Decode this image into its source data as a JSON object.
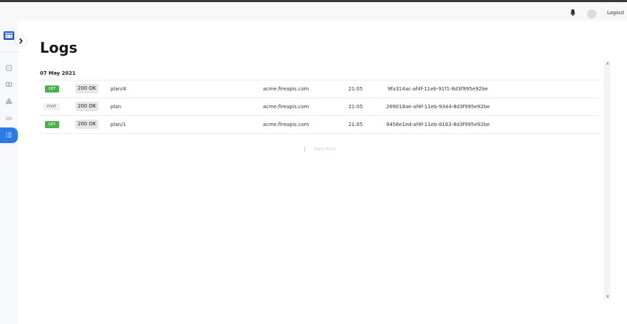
{
  "header": {
    "logout_label": "Logout",
    "icons": [
      "bell-icon",
      "avatar"
    ]
  },
  "sidebar": {
    "logo": "firetail-logo",
    "items": [
      {
        "icon": "document-icon",
        "active": false
      },
      {
        "icon": "id-card-icon",
        "active": false
      },
      {
        "icon": "integrations-icon",
        "active": false
      },
      {
        "icon": "code-icon",
        "active": false
      },
      {
        "icon": "list-icon",
        "active": true
      }
    ]
  },
  "page": {
    "title": "Logs"
  },
  "logs": {
    "date": "07 May 2021",
    "rows": [
      {
        "method": "GET",
        "status": "200 OK",
        "path": "plan/4",
        "host": "acme.fireapis.com",
        "time": "21:05",
        "id": "9fa314ac-af4f-11eb-91f1-8d3f995e92be"
      },
      {
        "method": "POST",
        "status": "200 OK",
        "path": "plan",
        "host": "acme.fireapis.com",
        "time": "21:05",
        "id": "269018ae-af4f-11eb-9344-8d3f995e92be"
      },
      {
        "method": "GET",
        "status": "200 OK",
        "path": "plan/1",
        "host": "acme.fireapis.com",
        "time": "21:05",
        "id": "9456e1ed-af4f-11eb-8163-8d3f995e92be"
      }
    ],
    "view_more_label": "View More"
  },
  "colors": {
    "accent": "#2c7be5",
    "get_badge": "#4caf50",
    "post_badge": "#f1f1f1"
  }
}
